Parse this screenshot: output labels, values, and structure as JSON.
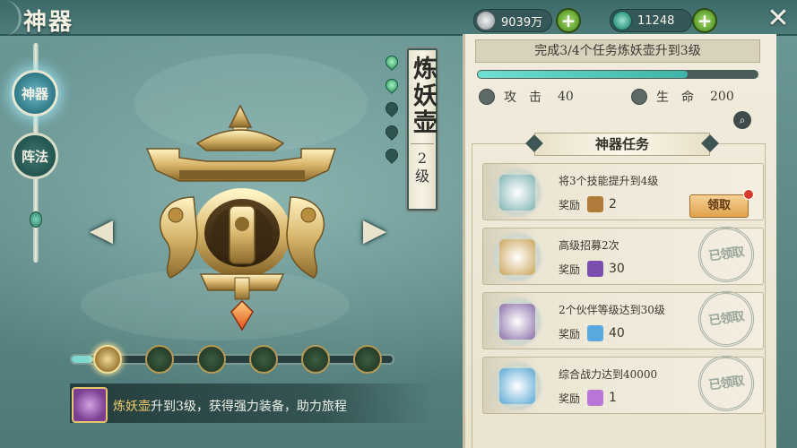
{
  "header": {
    "title": "神器",
    "silver": "9039万",
    "jade": "11248",
    "close_label": "✕"
  },
  "nav": {
    "items": [
      {
        "label": "神器",
        "active": true
      },
      {
        "label": "阵法",
        "active": false
      }
    ]
  },
  "artifact": {
    "name": "炼妖壶",
    "level_num": "2",
    "level_unit": "级",
    "stars_total": 5,
    "stars_lit": 2,
    "prev_label": "◀",
    "next_label": "▶"
  },
  "selector": {
    "count": 6,
    "active_index": 0
  },
  "tip": {
    "highlight": "炼妖壶",
    "text": "升到3级，获得强力装备，助力旅程"
  },
  "quest": {
    "header": "完成3/4个任务炼妖壶升到3级",
    "progress": 0.75,
    "attack_label": "攻击",
    "attack_value": "40",
    "hp_label": "生命",
    "hp_value": "200",
    "section_title": "神器任务"
  },
  "tasks": [
    {
      "name": "将3个技能提升到4级",
      "reward_label": "奖励",
      "reward_value": "2",
      "status": "claim",
      "claim_label": "领取",
      "icon": "scroll-icon",
      "reward_icon": "book-icon"
    },
    {
      "name": "高级招募2次",
      "reward_label": "奖励",
      "reward_value": "30",
      "status": "claimed",
      "claimed_label": "已领取",
      "icon": "bell-icon",
      "reward_icon": "gem-box-icon"
    },
    {
      "name": "2个伙伴等级达到30级",
      "reward_label": "奖励",
      "reward_value": "40",
      "status": "claimed",
      "claimed_label": "已领取",
      "icon": "portrait-icon",
      "reward_icon": "crystal-icon"
    },
    {
      "name": "综合战力达到40000",
      "reward_label": "奖励",
      "reward_value": "1",
      "status": "claimed",
      "claimed_label": "已领取",
      "icon": "wave-icon",
      "reward_icon": "fan-icon"
    }
  ],
  "colors": {
    "accent_jade": "#3fb3a6",
    "claim_orange": "#e0a24e",
    "panel_bg": "#f1ecdd",
    "bg_teal": "#5f8d8c"
  }
}
